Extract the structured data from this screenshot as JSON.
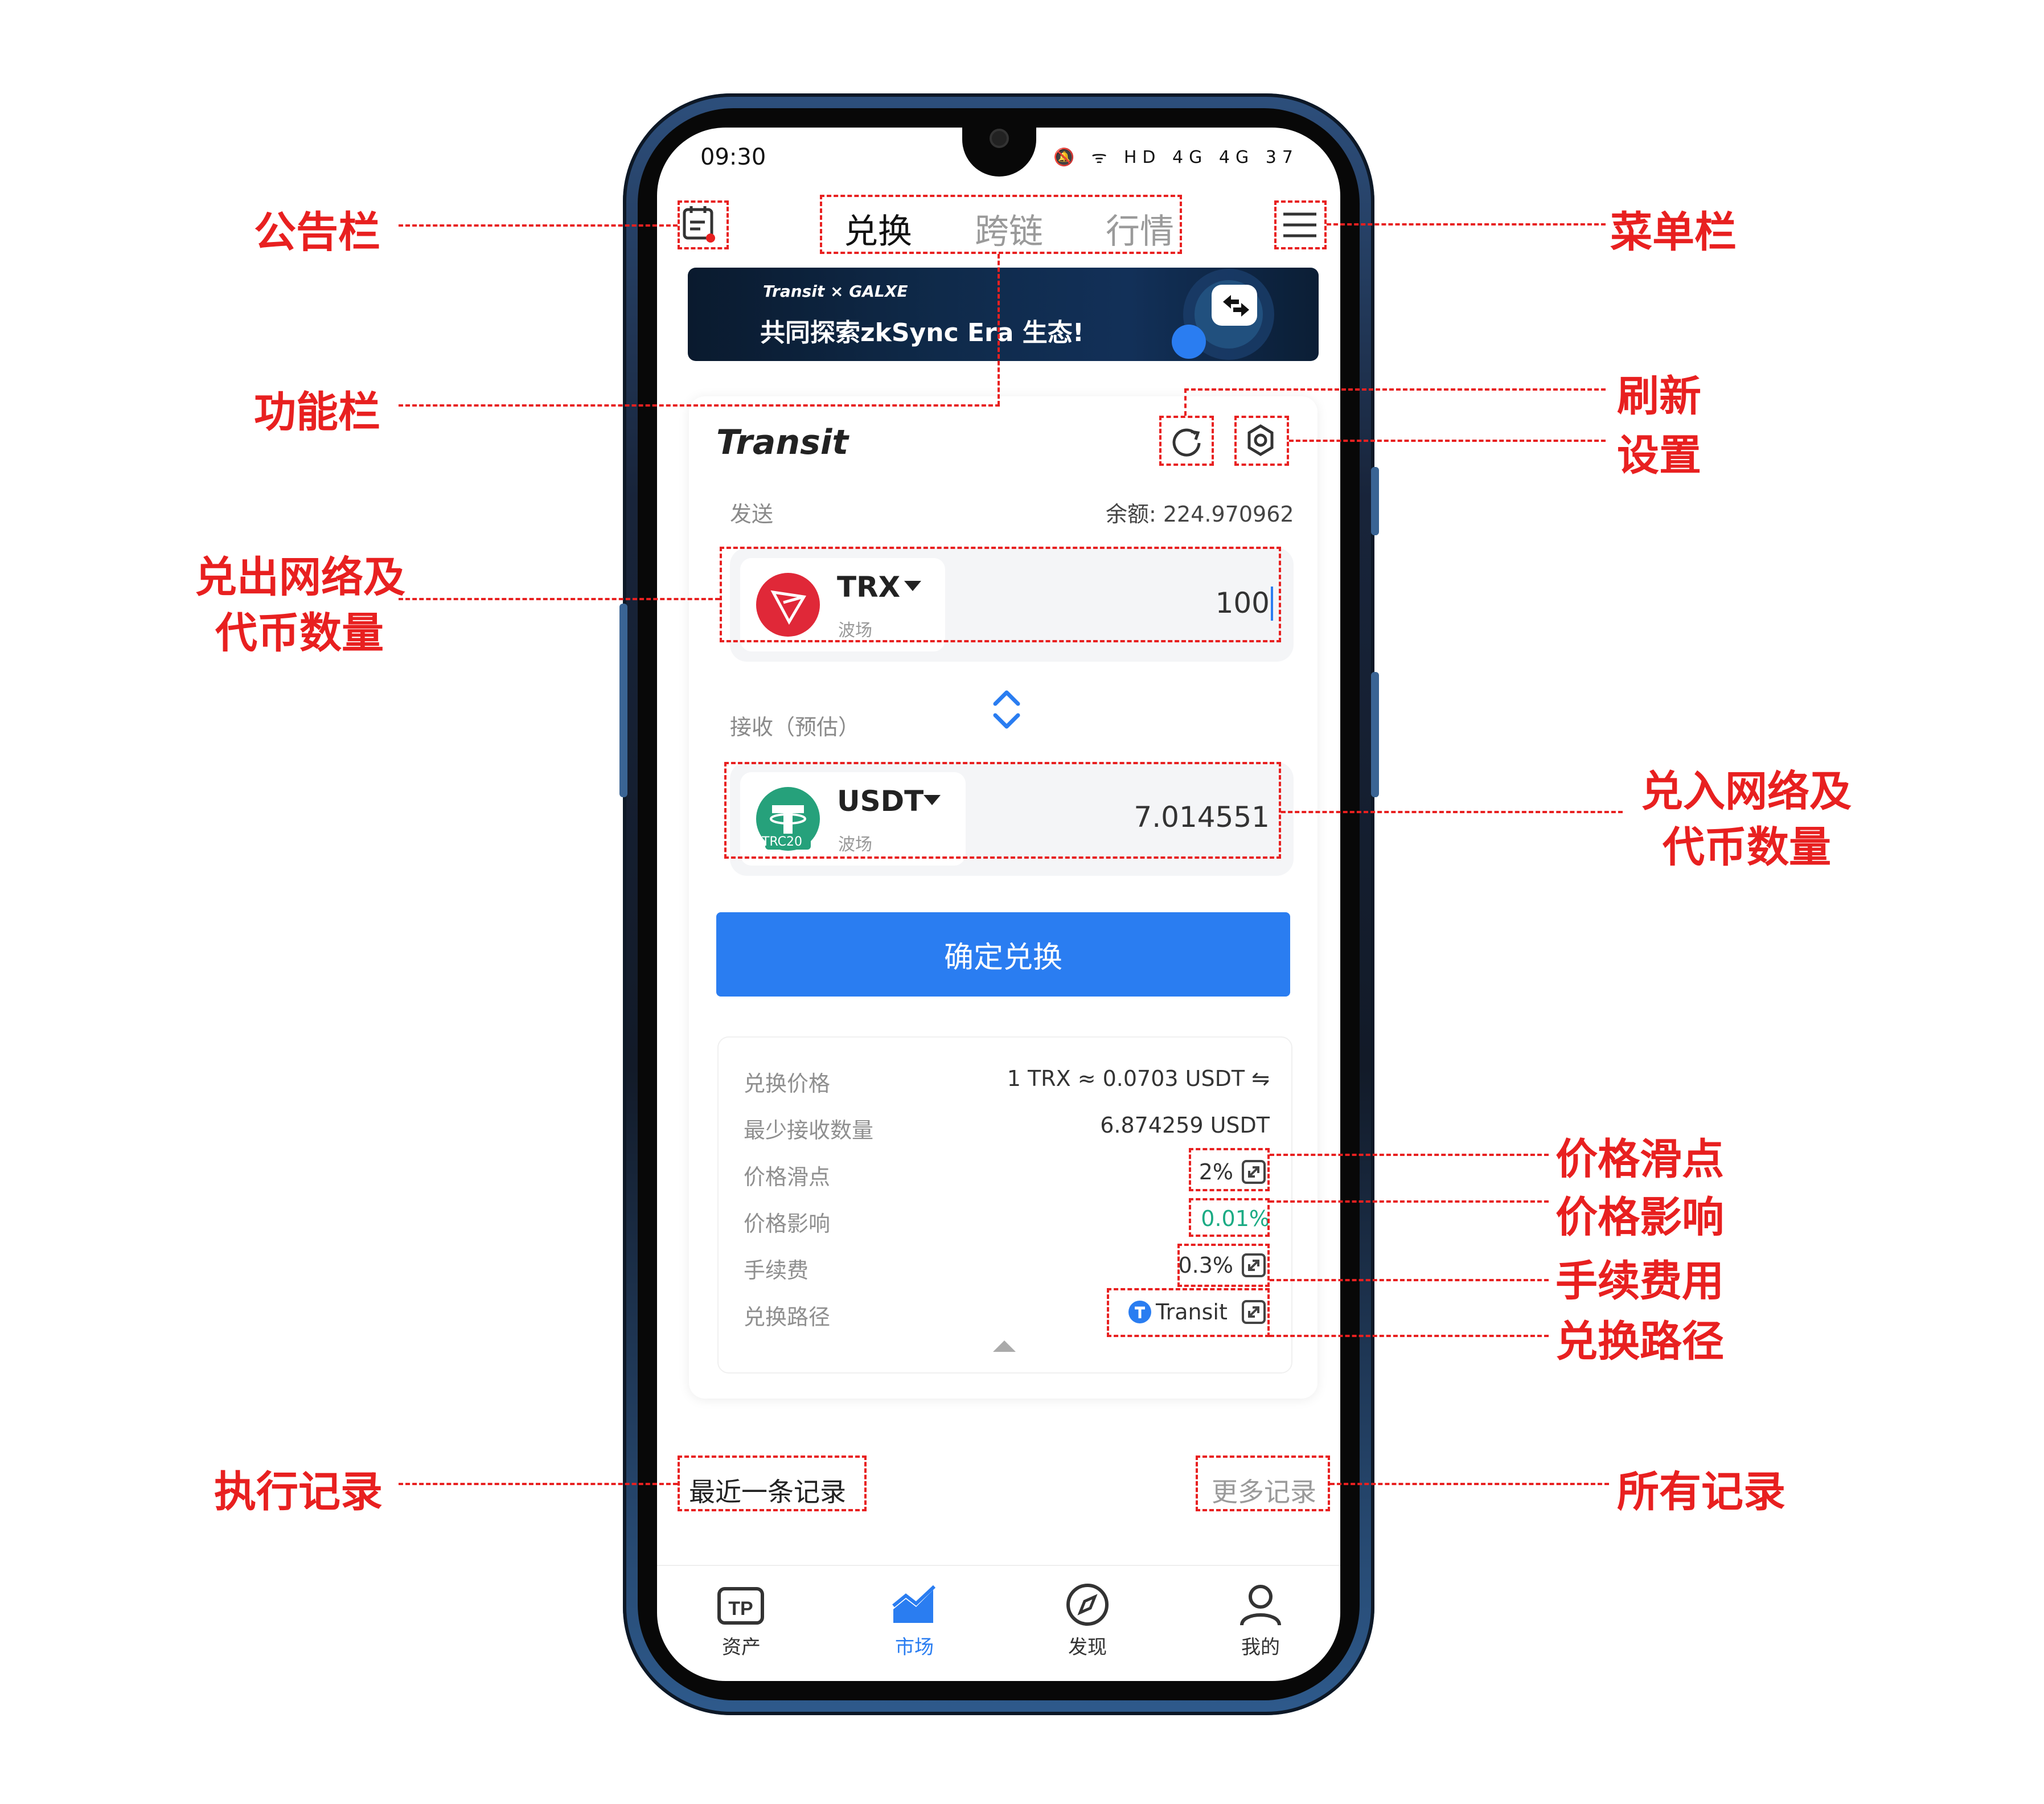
{
  "status_bar": {
    "time": "09:30",
    "icons": "🔕 ᯤ HD 4G 4G 37"
  },
  "top_nav": {
    "tabs": [
      "兑换",
      "跨链",
      "行情"
    ],
    "active_tab": 0
  },
  "banner": {
    "brand": "Transit × GALXE",
    "text": "共同探索zkSync Era 生态!"
  },
  "card": {
    "brand": "Transit",
    "send_label": "发送",
    "balance": "余额: 224.970962",
    "from": {
      "symbol": "TRX",
      "chain": "波场",
      "amount": "100"
    },
    "receive_label": "接收（预估）",
    "to": {
      "symbol": "USDT",
      "chain": "波场",
      "badge": "TRC20",
      "amount": "7.014551"
    },
    "confirm_label": "确定兑换"
  },
  "details": {
    "rows": [
      {
        "label": "兑换价格",
        "value": "1 TRX ≈ 0.0703 USDT ⇋"
      },
      {
        "label": "最少接收数量",
        "value": "6.874259 USDT"
      },
      {
        "label": "价格滑点",
        "value": "2%"
      },
      {
        "label": "价格影响",
        "value": "0.01%"
      },
      {
        "label": "手续费",
        "value": "0.3%"
      },
      {
        "label": "兑换路径",
        "value": "Transit"
      }
    ]
  },
  "records": {
    "recent": "最近一条记录",
    "more": "更多记录"
  },
  "bottom_nav": {
    "items": [
      {
        "label": "资产",
        "icon": "wallet-icon"
      },
      {
        "label": "市场",
        "icon": "market-chart-icon"
      },
      {
        "label": "发现",
        "icon": "compass-icon"
      },
      {
        "label": "我的",
        "icon": "user-icon"
      }
    ],
    "active": 1
  },
  "annotations": {
    "announcement": "公告栏",
    "function_bar": "功能栏",
    "send_network_line1": "兑出网络及",
    "send_network_line2": "代币数量",
    "exec_record": "执行记录",
    "menu_bar": "菜单栏",
    "refresh": "刷新",
    "settings": "设置",
    "receive_network_line1": "兑入网络及",
    "receive_network_line2": "代币数量",
    "slippage": "价格滑点",
    "impact": "价格影响",
    "fee": "手续费用",
    "route": "兑换路径",
    "all_records": "所有记录"
  },
  "colors": {
    "accent": "#2a7df1",
    "annotation": "#e82020",
    "green": "#1bab84",
    "trx": "#e02838",
    "usdt": "#26a17b"
  }
}
